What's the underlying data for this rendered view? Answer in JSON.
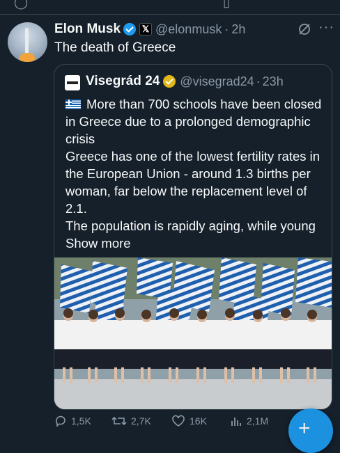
{
  "post": {
    "author_name": "Elon Musk",
    "author_handle": "@elonmusk",
    "separator": "·",
    "time": "2h",
    "text": "The death of Greece"
  },
  "quoted": {
    "author_name": "Visegrád 24",
    "author_handle": "@visegrad24",
    "separator": "·",
    "time": "23h",
    "lines": [
      "More than 700 schools have been closed in Greece due to a prolonged demographic crisis",
      "Greece has one of the lowest fertility rates in the European Union - around 1.3 births per woman, far below the replacement level of 2.1.",
      "The population is rapidly aging, while young"
    ],
    "show_more": "Show more"
  },
  "actions": {
    "replies": "1,5K",
    "reposts": "2,7K",
    "likes": "16K",
    "views": "2,1M"
  },
  "colors": {
    "background": "#15202b",
    "accent": "#1d9bf0",
    "muted": "#8b98a5",
    "gold_badge": "#e2b719"
  },
  "icons": [
    "reply-icon",
    "repost-icon",
    "like-icon",
    "views-icon",
    "bookmark-icon",
    "share-icon",
    "grok-icon",
    "more-icon",
    "compose-icon"
  ]
}
